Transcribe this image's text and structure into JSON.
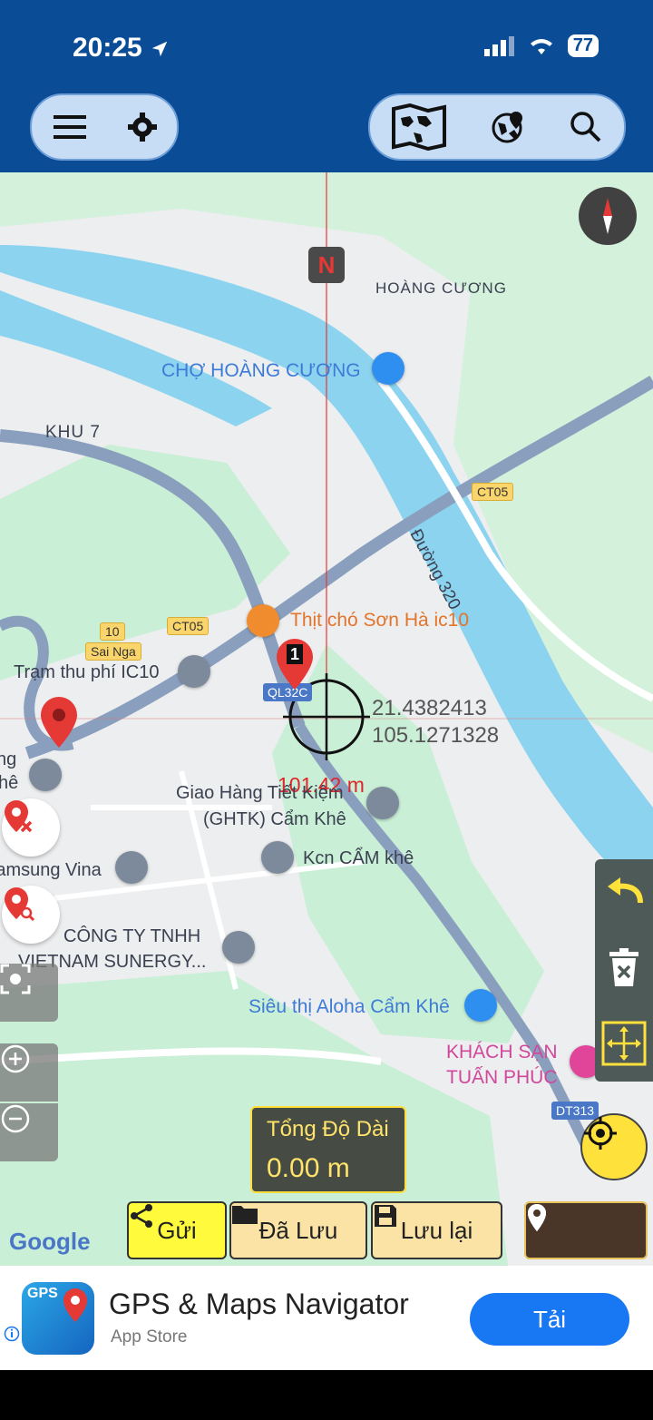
{
  "status_bar": {
    "time": "20:25",
    "battery": "77"
  },
  "toolbar": {
    "left": [
      "menu-icon",
      "gear-icon"
    ],
    "right": [
      "world-map-icon",
      "globe-pin-icon",
      "search-icon"
    ]
  },
  "map": {
    "north_marker": "N",
    "labels": {
      "hoang_cuong": "HOÀNG CƯƠNG",
      "cho_hoang_cuong": "CHỢ HOÀNG CƯƠNG",
      "khu7": "KHU 7",
      "duong320": "Đường 320",
      "thit_cho": "Thịt chó Sơn Hà ic10",
      "sai_nga": "Sai Nga",
      "tram_thu_phi": "Trạm thu phí IC10",
      "giao_hang_1": "Giao Hàng Tiết Kiệm",
      "giao_hang_2": "(GHTK) Cẩm Khê",
      "kcn": "Kcn CẨM khê",
      "samsung": "Samsung Vina",
      "cong_ty_1": "CÔNG TY TNHH",
      "cong_ty_2": "VIETNAM SUNERGY...",
      "sieu_thi": "Siêu thị Aloha Cẩm Khê",
      "khach_san_1": "KHÁCH SẠN",
      "khach_san_2": "TUẤN PHÚC",
      "left_cut_1": "ng",
      "left_cut_2": "hê"
    },
    "road_badges": {
      "ct05_a": "CT05",
      "ct05_b": "CT05",
      "r10": "10",
      "ql32": "QL32C",
      "dt313": "DT313"
    },
    "marker_label": "1",
    "coordinates": {
      "lat": "21.4382413",
      "lon": "105.1271328"
    },
    "distance": "101.42 m",
    "total_length": {
      "title": "Tổng Độ Dài",
      "value": "0.00 m"
    },
    "google": "Google"
  },
  "actions": {
    "send": "Gửi",
    "saved": "Đã Lưu",
    "save": "Lưu lại"
  },
  "ad": {
    "title": "GPS & Maps Navigator",
    "subtitle": "App Store",
    "button": "Tải",
    "icon_text": "GPS"
  },
  "colors": {
    "header": "#0a4d96",
    "river": "#8cd3ef",
    "green": "#c9efd6",
    "highway": "#7f97b8",
    "accent_yellow": "#ffe13c",
    "pin_red": "#e53935"
  }
}
